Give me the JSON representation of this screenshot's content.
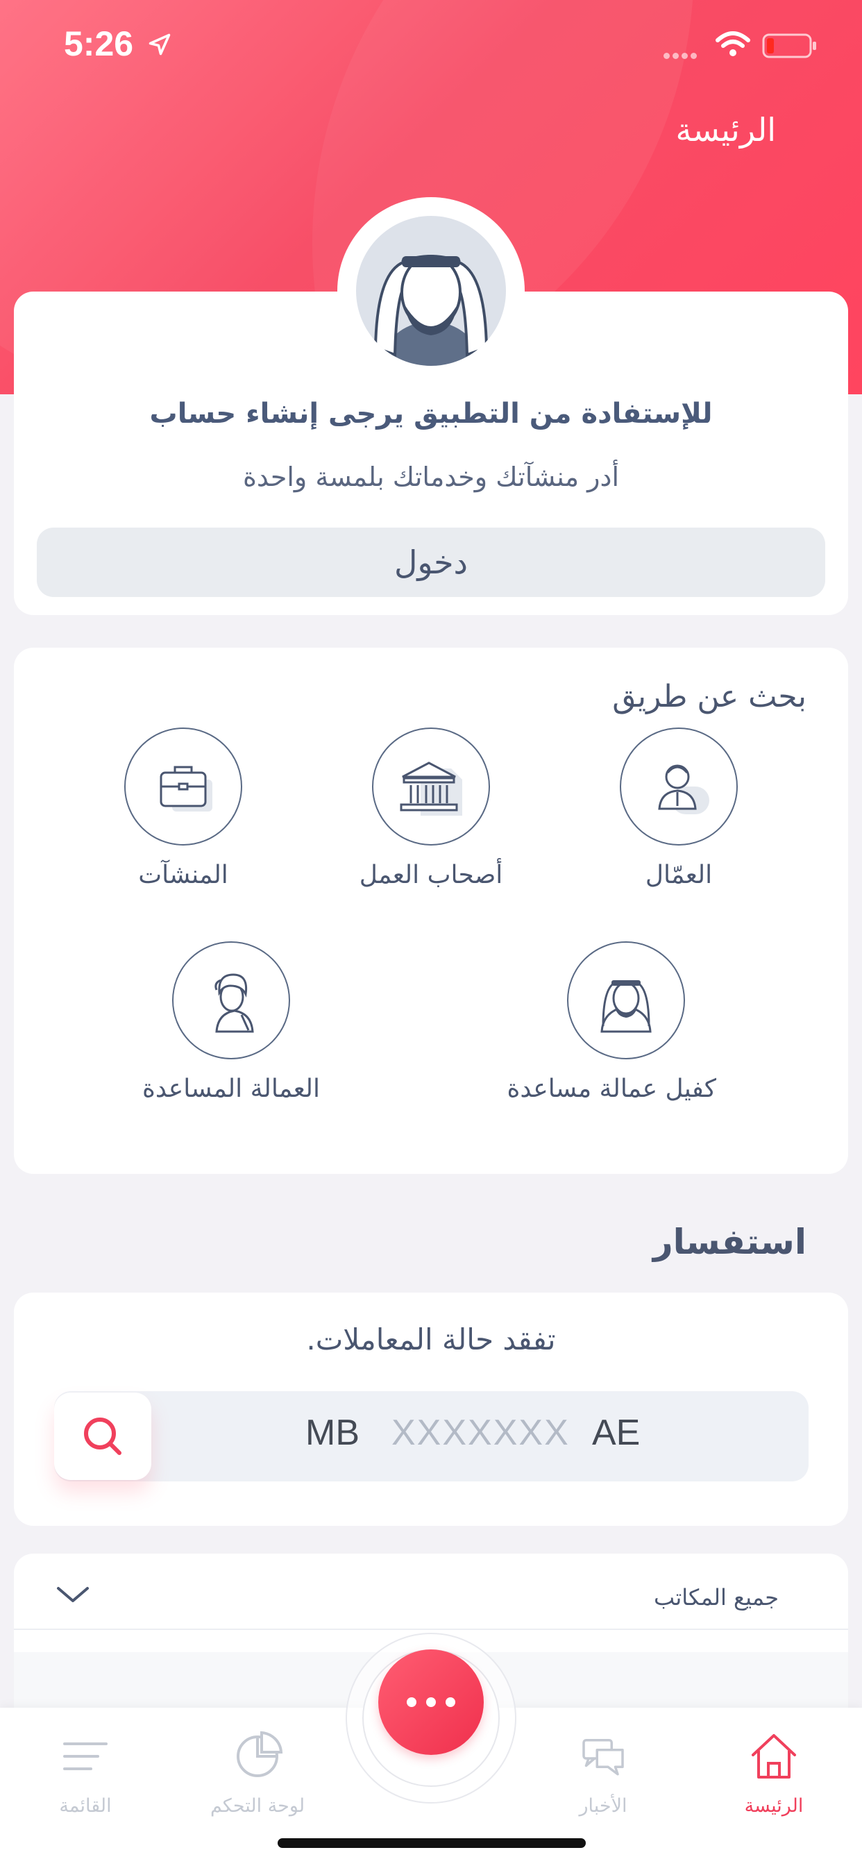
{
  "status_bar": {
    "time": "5:26"
  },
  "header": {
    "title": "الرئيسة"
  },
  "login": {
    "heading": "للإستفادة من التطبيق يرجى إنشاء حساب",
    "subtitle": "أدر منشآتك وخدماتك بلمسة واحدة",
    "button_label": "دخول"
  },
  "search_by": {
    "title": "بحث عن طريق",
    "items": [
      {
        "label": "العمّال",
        "icon": "worker-icon"
      },
      {
        "label": "أصحاب العمل",
        "icon": "employer-building-icon"
      },
      {
        "label": "المنشآت",
        "icon": "briefcase-icon"
      },
      {
        "label": "كفيل عمالة مساعدة",
        "icon": "sponsor-icon"
      },
      {
        "label": "العمالة المساعدة",
        "icon": "domestic-worker-icon"
      }
    ]
  },
  "inquiry": {
    "title": "استفسار",
    "subtitle": "تفقد حالة المعاملات.",
    "prefix": "MB",
    "placeholder": "XXXXXXX",
    "suffix": "AE"
  },
  "offices": {
    "label": "جميع المكاتب"
  },
  "tabbar": {
    "items": [
      {
        "label": "الرئيسة",
        "icon": "home-icon",
        "active": true
      },
      {
        "label": "الأخبار",
        "icon": "news-chat-icon",
        "active": false
      },
      {
        "label": "لوحة التحكم",
        "icon": "dashboard-pie-icon",
        "active": false
      },
      {
        "label": "القائمة",
        "icon": "menu-lines-icon",
        "active": false
      }
    ]
  },
  "colors": {
    "accent": "#F0405C",
    "text": "#4A5670",
    "background": "#F3F2F6"
  }
}
